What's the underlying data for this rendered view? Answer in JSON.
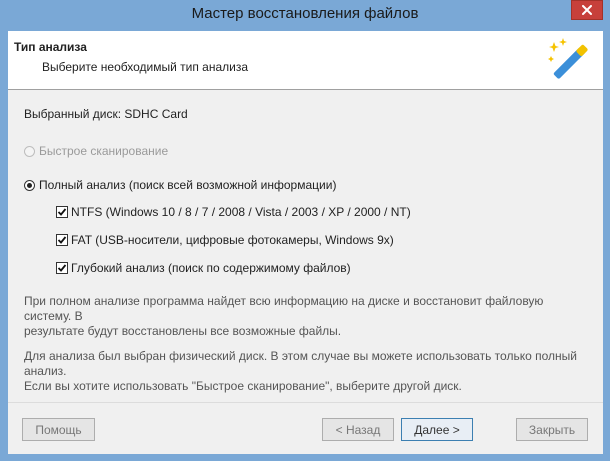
{
  "window": {
    "title": "Мастер восстановления файлов"
  },
  "header": {
    "title": "Тип анализа",
    "subtitle": "Выберите необходимый тип анализа",
    "icon": "magic-wand-icon"
  },
  "selected_disk": "Выбранный диск: SDHC Card",
  "options": {
    "quick_scan": {
      "label": "Быстрое сканирование",
      "checked": false,
      "enabled": false
    },
    "full_analysis": {
      "label": "Полный анализ (поиск всей возможной информации)",
      "checked": true,
      "enabled": true
    },
    "ntfs": {
      "label": "NTFS (Windows 10 / 8 / 7 / 2008 / Vista / 2003 / XP / 2000 / NT)",
      "checked": true
    },
    "fat": {
      "label": "FAT (USB-носители, цифровые фотокамеры, Windows 9x)",
      "checked": true
    },
    "deep": {
      "label": "Глубокий анализ (поиск по содержимому файлов)",
      "checked": true
    }
  },
  "info1": {
    "line1": "При полном анализе программа найдет всю информацию на диске и восстановит файловую систему. В",
    "line2": "результате будут восстановлены все возможные файлы."
  },
  "info2": {
    "line1": "Для анализа был выбран физический диск. В этом случае вы можете использовать только полный анализ.",
    "line2": "Если вы хотите использовать \"Быстрое сканирование\", выберите другой диск."
  },
  "buttons": {
    "help": "Помощь",
    "back": "< Назад",
    "next": "Далее >",
    "close": "Закрыть"
  },
  "colors": {
    "accent": "#3c7fb1",
    "titlebar": "#7aa8d6",
    "close": "#c7403a"
  }
}
